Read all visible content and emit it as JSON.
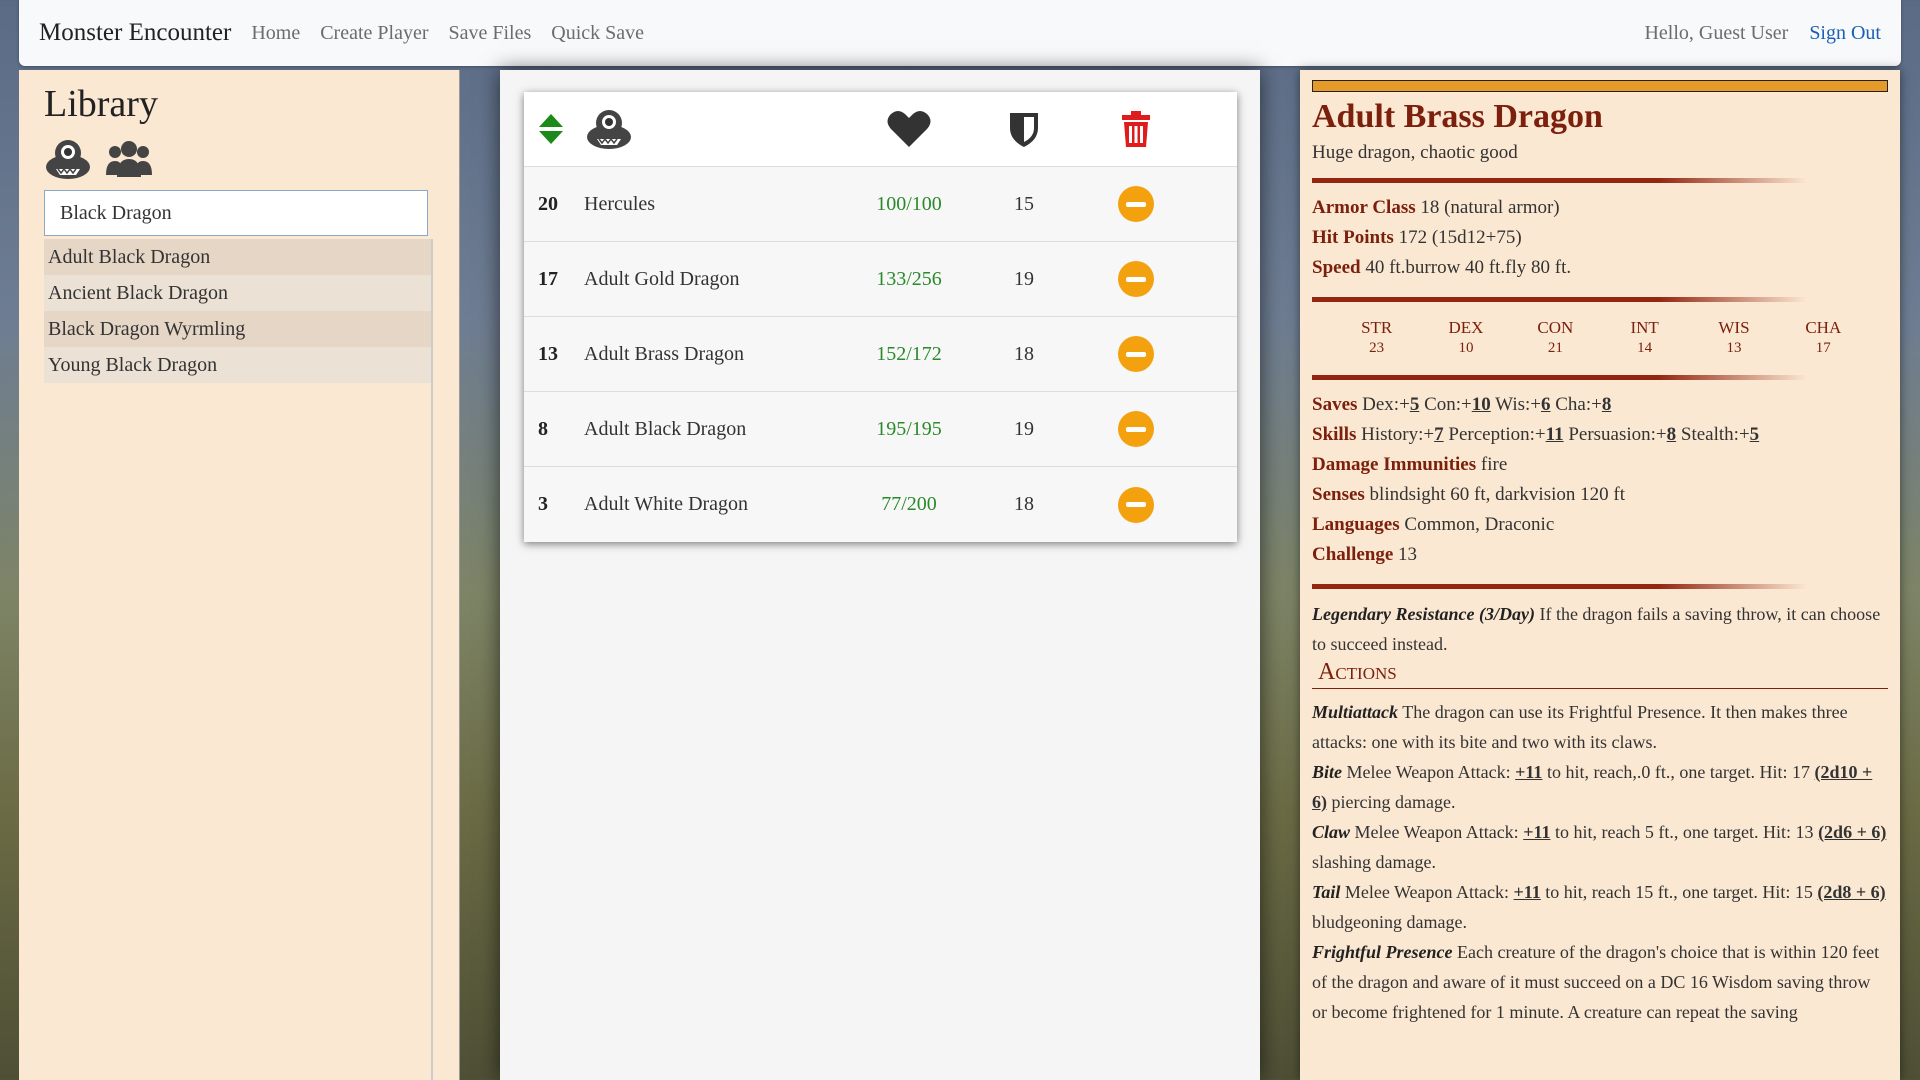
{
  "nav": {
    "brand": "Monster Encounter",
    "links": [
      "Home",
      "Create Player",
      "Save Files",
      "Quick Save"
    ],
    "greeting": "Hello, Guest User",
    "signout": "Sign Out"
  },
  "library": {
    "title": "Library",
    "search_value": "Black Dragon",
    "results": [
      "Adult Black Dragon",
      "Ancient Black Dragon",
      "Black Dragon Wyrmling",
      "Young Black Dragon"
    ]
  },
  "encounter": {
    "rows": [
      {
        "init": "20",
        "name": "Hercules",
        "hp": "100/100",
        "ac": "15"
      },
      {
        "init": "17",
        "name": "Adult Gold Dragon",
        "hp": "133/256",
        "ac": "19"
      },
      {
        "init": "13",
        "name": "Adult Brass Dragon",
        "hp": "152/172",
        "ac": "18"
      },
      {
        "init": "8",
        "name": "Adult Black Dragon",
        "hp": "195/195",
        "ac": "19"
      },
      {
        "init": "3",
        "name": "Adult White Dragon",
        "hp": "77/200",
        "ac": "18"
      }
    ]
  },
  "stat": {
    "name": "Adult Brass Dragon",
    "type": "Huge dragon, chaotic good",
    "armor_class_label": "Armor Class",
    "armor_class": "18 (natural armor)",
    "hit_points_label": "Hit Points",
    "hit_points": "172 (15d12+75)",
    "speed_label": "Speed",
    "speed": "40 ft.burrow 40 ft.fly 80 ft.",
    "abilities": [
      {
        "name": "STR",
        "value": "23"
      },
      {
        "name": "DEX",
        "value": "10"
      },
      {
        "name": "CON",
        "value": "21"
      },
      {
        "name": "INT",
        "value": "14"
      },
      {
        "name": "WIS",
        "value": "13"
      },
      {
        "name": "CHA",
        "value": "17"
      }
    ],
    "saves_label": "Saves",
    "saves": [
      {
        "prefix": "Dex:+",
        "val": "5"
      },
      {
        "prefix": "Con:+",
        "val": "10"
      },
      {
        "prefix": "Wis:+",
        "val": "6"
      },
      {
        "prefix": "Cha:+",
        "val": "8"
      }
    ],
    "skills_label": "Skills",
    "skills": [
      {
        "prefix": "History:+",
        "val": "7"
      },
      {
        "prefix": "Perception:+",
        "val": "11"
      },
      {
        "prefix": "Persuasion:+",
        "val": "8"
      },
      {
        "prefix": "Stealth:+",
        "val": "5"
      }
    ],
    "immunities_label": "Damage Immunities",
    "immunities": "fire",
    "senses_label": "Senses",
    "senses": "blindsight 60 ft, darkvision 120 ft",
    "languages_label": "Languages",
    "languages": "Common, Draconic",
    "challenge_label": "Challenge",
    "challenge": "13",
    "legendary_title": "Legendary Resistance (3/Day)",
    "legendary_text": "If the dragon fails a saving throw, it can choose to succeed instead.",
    "actions_heading": "Actions",
    "multiattack_title": "Multiattack",
    "multiattack_text": "The dragon can use its Frightful Presence. It then makes three attacks: one with its bite and two with its claws.",
    "bite_title": "Bite",
    "bite_pre": "Melee Weapon Attack:",
    "bite_bonus": "+11",
    "bite_mid": "to hit, reach,.0 ft., one target. Hit: 17",
    "bite_dice": "(2d10 + 6)",
    "bite_post": "piercing damage.",
    "claw_title": "Claw",
    "claw_pre": "Melee Weapon Attack:",
    "claw_bonus": "+11",
    "claw_mid": "to hit, reach 5 ft., one target. Hit: 13",
    "claw_dice": "(2d6 + 6)",
    "claw_post": "slashing damage.",
    "tail_title": "Tail",
    "tail_pre": "Melee Weapon Attack:",
    "tail_bonus": "+11",
    "tail_mid": "to hit, reach 15 ft., one target. Hit: 15",
    "tail_dice": "(2d8 + 6)",
    "tail_post": "bludgeoning damage.",
    "frightful_title": "Frightful Presence",
    "frightful_text": "Each creature of the dragon's choice that is within 120 feet of the dragon and aware of it must succeed on a DC 16 Wisdom saving throw or become frightened for 1 minute. A creature can repeat the saving"
  },
  "colors": {
    "accent_orange": "#f4a10f",
    "hp_green": "#2a8a2a",
    "delete_red": "#e01b1b",
    "stat_red": "#7a200d"
  }
}
